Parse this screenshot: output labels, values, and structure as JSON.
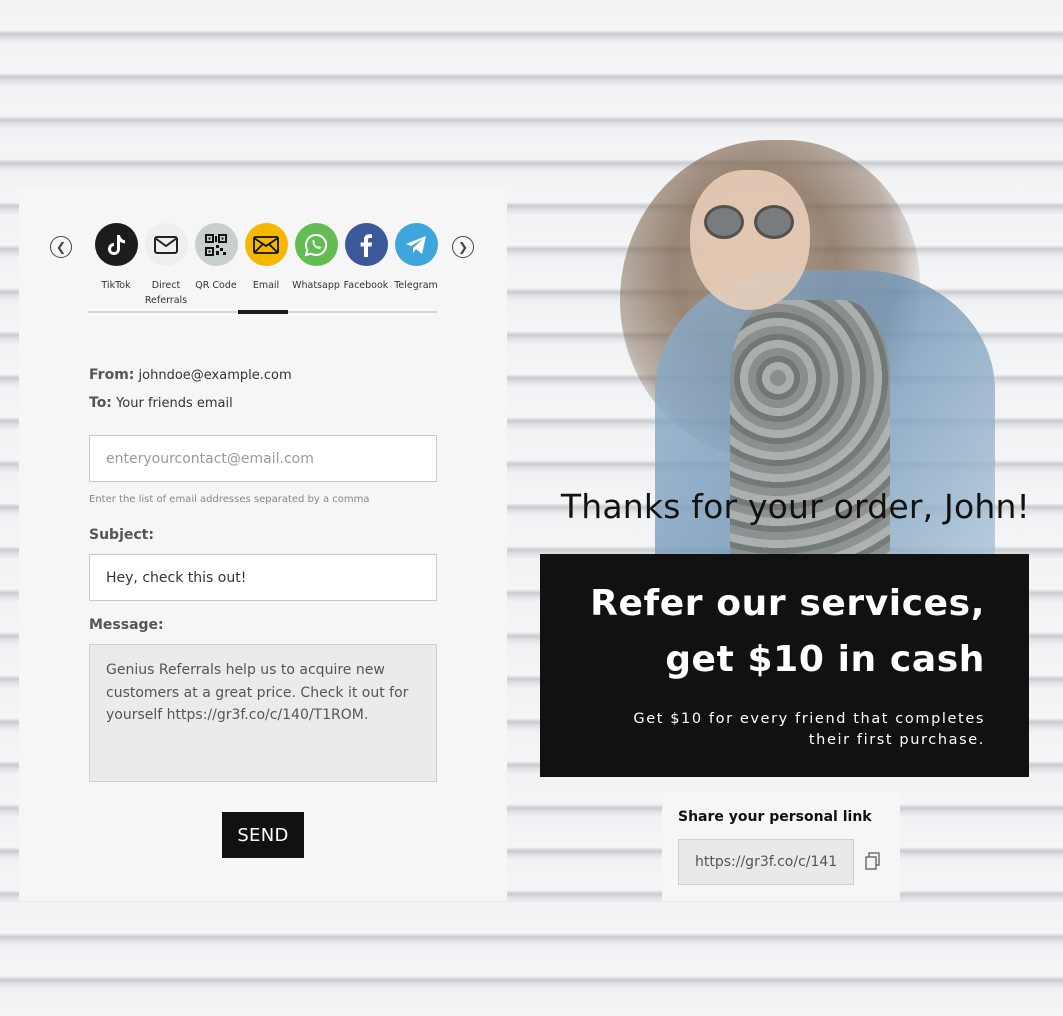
{
  "share": {
    "prev_label": "previous",
    "next_label": "next",
    "items": [
      {
        "label": "TikTok",
        "icon": "tiktok-icon",
        "color": "#1c1c1c"
      },
      {
        "label": "Direct Referrals",
        "icon": "envelope-icon",
        "color": "#eeeeee"
      },
      {
        "label": "QR Code",
        "icon": "qr-code-icon",
        "color": "#c8cfcf"
      },
      {
        "label": "Email",
        "icon": "envelope-icon",
        "color": "#f5b800"
      },
      {
        "label": "Whatsapp",
        "icon": "whatsapp-icon",
        "color": "#65bc54"
      },
      {
        "label": "Facebook",
        "icon": "facebook-icon",
        "color": "#3b5998"
      },
      {
        "label": "Telegram",
        "icon": "telegram-icon",
        "color": "#3ea5dd"
      }
    ],
    "active_tab": "Email"
  },
  "form": {
    "from_label": "From:",
    "from_value": "johndoe@example.com",
    "to_label": "To:",
    "to_value": "Your friends email",
    "to_placeholder": "enteryourcontact@email.com",
    "to_hint": "Enter the list of email addresses separated by a comma",
    "subject_label": "Subject:",
    "subject_value": "Hey, check this out!",
    "message_label": "Message:",
    "message_value": "Genius Referrals help us to acquire new customers at a great price. Check it out for yourself https://gr3f.co/c/140/T1ROM.",
    "send_label": "SEND"
  },
  "hero": {
    "thanks": "Thanks for your order, John!",
    "headline_line1": "Refer our services,",
    "headline_line2": "get $10 in cash",
    "subtext": "Get $10 for every friend that completes their first purchase."
  },
  "link": {
    "title": "Share your personal link",
    "url": "https://gr3f.co/c/141"
  }
}
